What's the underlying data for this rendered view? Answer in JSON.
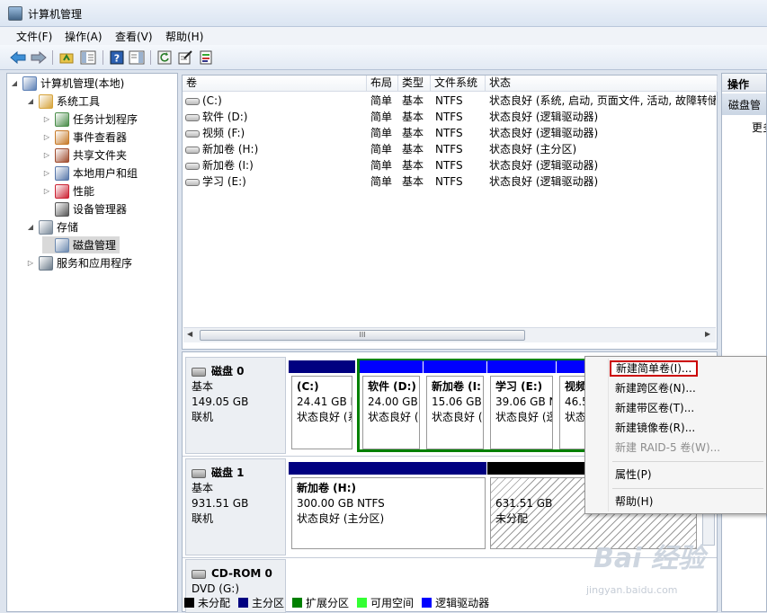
{
  "window": {
    "title": "计算机管理"
  },
  "menubar": {
    "items": [
      "文件(F)",
      "操作(A)",
      "查看(V)",
      "帮助(H)"
    ]
  },
  "tree": [
    {
      "label": "计算机管理(本地)",
      "depth": 0,
      "expanded": true
    },
    {
      "label": "系统工具",
      "depth": 1,
      "expanded": true
    },
    {
      "label": "任务计划程序",
      "depth": 2,
      "expanded": false
    },
    {
      "label": "事件查看器",
      "depth": 2,
      "expanded": false
    },
    {
      "label": "共享文件夹",
      "depth": 2,
      "expanded": false
    },
    {
      "label": "本地用户和组",
      "depth": 2,
      "expanded": false
    },
    {
      "label": "性能",
      "depth": 2,
      "expanded": false
    },
    {
      "label": "设备管理器",
      "depth": 2,
      "leaf": true
    },
    {
      "label": "存储",
      "depth": 1,
      "expanded": true
    },
    {
      "label": "磁盘管理",
      "depth": 2,
      "leaf": true,
      "selected": true
    },
    {
      "label": "服务和应用程序",
      "depth": 1,
      "expanded": false
    }
  ],
  "volumes": {
    "headers": [
      "卷",
      "布局",
      "类型",
      "文件系统",
      "状态"
    ],
    "rows": [
      [
        "(C:)",
        "简单",
        "基本",
        "NTFS",
        "状态良好 (系统, 启动, 页面文件, 活动, 故障转储"
      ],
      [
        "软件 (D:)",
        "简单",
        "基本",
        "NTFS",
        "状态良好 (逻辑驱动器)"
      ],
      [
        "视频 (F:)",
        "简单",
        "基本",
        "NTFS",
        "状态良好 (逻辑驱动器)"
      ],
      [
        "新加卷 (H:)",
        "简单",
        "基本",
        "NTFS",
        "状态良好 (主分区)"
      ],
      [
        "新加卷 (I:)",
        "简单",
        "基本",
        "NTFS",
        "状态良好 (逻辑驱动器)"
      ],
      [
        "学习 (E:)",
        "简单",
        "基本",
        "NTFS",
        "状态良好 (逻辑驱动器)"
      ]
    ],
    "scroll_grip": "III"
  },
  "disks": [
    {
      "name": "磁盘 0",
      "type": "基本",
      "size": "149.05 GB",
      "status": "联机",
      "partitions": [
        {
          "title": "(C:)",
          "size": "24.41 GB N",
          "status": "状态良好 (系"
        },
        {
          "title": "软件 (D:)",
          "size": "24.00 GB",
          "status": "状态良好 ("
        },
        {
          "title": "新加卷 (I:",
          "size": "15.06 GB",
          "status": "状态良好 ("
        },
        {
          "title": "学习 (E:)",
          "size": "39.06 GB N",
          "status": "状态良好 (逻"
        },
        {
          "title": "视频",
          "size": "46.5",
          "status": "状态"
        }
      ]
    },
    {
      "name": "磁盘 1",
      "type": "基本",
      "size": "931.51 GB",
      "status": "联机",
      "partitions": [
        {
          "title": "新加卷 (H:)",
          "size": "300.00 GB NTFS",
          "status": "状态良好 (主分区)"
        },
        {
          "title": "",
          "size": "631.51 GB",
          "status": "未分配"
        }
      ]
    },
    {
      "name": "CD-ROM 0",
      "type": "DVD (G:)"
    }
  ],
  "legend": [
    {
      "label": "未分配",
      "color": "#000000"
    },
    {
      "label": "主分区",
      "color": "#000080"
    },
    {
      "label": "扩展分区",
      "color": "#008000"
    },
    {
      "label": "可用空间",
      "color": "#33ff33"
    },
    {
      "label": "逻辑驱动器",
      "color": "#0000ff"
    }
  ],
  "actions": {
    "header": "操作",
    "selected": "磁盘管",
    "more": "更多"
  },
  "context_menu": {
    "items": [
      {
        "label": "新建简单卷(I)...",
        "enabled": true,
        "highlighted": true
      },
      {
        "label": "新建跨区卷(N)...",
        "enabled": true
      },
      {
        "label": "新建带区卷(T)...",
        "enabled": true
      },
      {
        "label": "新建镜像卷(R)...",
        "enabled": true
      },
      {
        "label": "新建 RAID-5 卷(W)...",
        "enabled": false
      },
      {
        "label": "属性(P)",
        "enabled": true
      },
      {
        "label": "帮助(H)",
        "enabled": true
      }
    ]
  },
  "watermark": {
    "brand": "Bai 经验",
    "url": "jingyan.baidu.com"
  },
  "colors": {
    "primary": "#000080",
    "logical": "#0000ff",
    "extended": "#008000",
    "highlight_border": "#cc0000"
  }
}
